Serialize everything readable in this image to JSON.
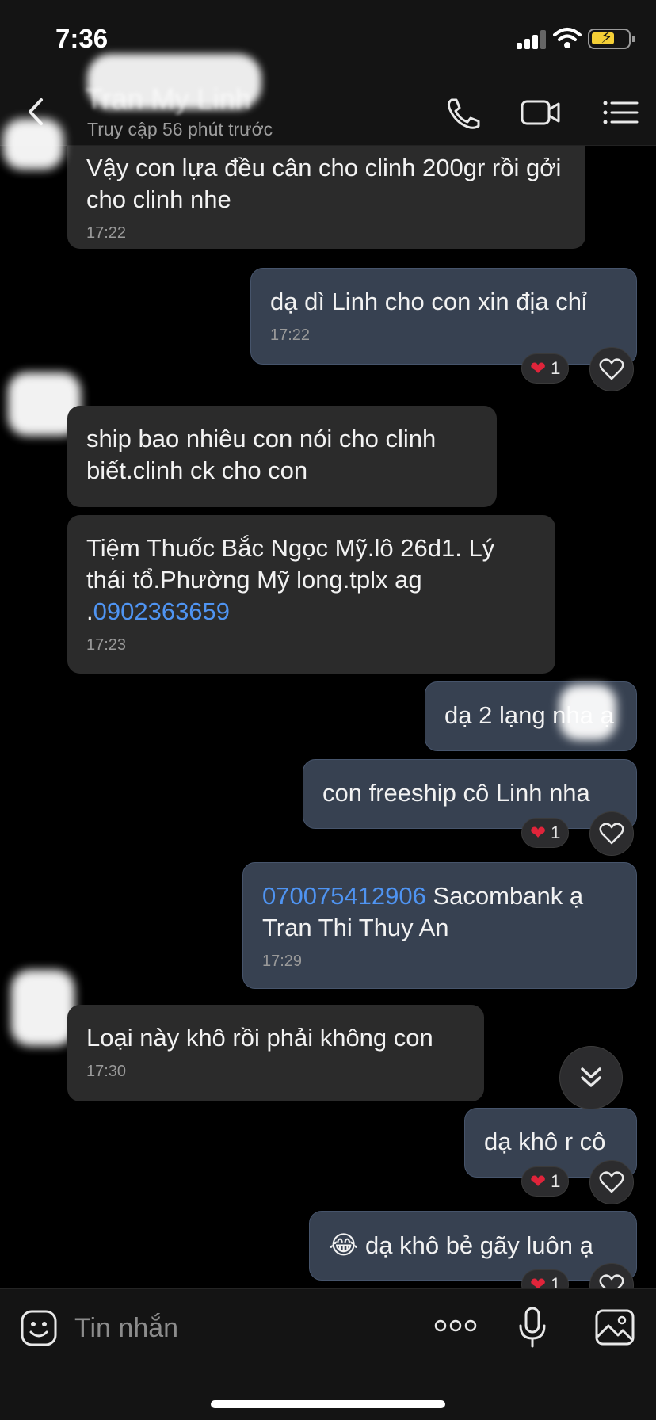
{
  "status_bar": {
    "time": "7:36"
  },
  "header": {
    "contact_name": "Tran My Linh",
    "last_seen": "Truy cập 56 phút trước",
    "icons": [
      "back-chevron-icon",
      "phone-icon",
      "video-camera-icon",
      "list-menu-icon"
    ]
  },
  "messages": [
    {
      "dir": "in",
      "text": "Vậy con lựa đều cân cho clinh 200gr rồi gởi cho clinh nhe",
      "time": "17:22"
    },
    {
      "dir": "out",
      "text": "dạ dì Linh cho con xin địa chỉ",
      "time": "17:22",
      "reaction_count": "1"
    },
    {
      "dir": "in",
      "text": "ship bao nhiêu con nói cho clinh biết.clinh ck cho con"
    },
    {
      "dir": "in",
      "text_prefix": "Tiệm Thuốc Bắc Ngọc Mỹ.lô 26d1. Lý thái tổ.Phường Mỹ long.tplx ag .",
      "phone": "0902363659",
      "time": "17:23"
    },
    {
      "dir": "out",
      "text": "dạ 2 lạng nha ạ"
    },
    {
      "dir": "out",
      "text": "con freeship cô Linh nha",
      "reaction_count": "1"
    },
    {
      "dir": "out",
      "account": "070075412906",
      "text_suffix": " Sacombank ạ Tran Thi Thuy An",
      "time": "17:29"
    },
    {
      "dir": "in",
      "text": "Loại này khô rồi phải không con",
      "time": "17:30"
    },
    {
      "dir": "out",
      "text": "dạ khô r cô",
      "reaction_count": "1"
    },
    {
      "dir": "out",
      "emoji": "😂",
      "text": " dạ khô bẻ gãy luôn ạ",
      "reaction_count": "1"
    }
  ],
  "input_bar": {
    "placeholder": "Tin nhắn",
    "icons": [
      "sticker-icon",
      "more-dots-icon",
      "microphone-icon",
      "gallery-icon"
    ]
  },
  "colors": {
    "incoming_bubble": "#2b2b2b",
    "outgoing_bubble": "#374151",
    "link": "#4f94f2",
    "heart": "#e0243a"
  }
}
